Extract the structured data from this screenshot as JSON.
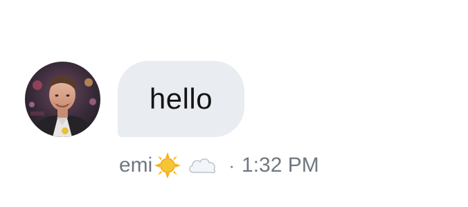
{
  "message": {
    "text": "hello",
    "sender": {
      "name": "emi",
      "status_icons": [
        "sun-emoji",
        "cloud-emoji"
      ],
      "avatar_icon": "profile-photo"
    },
    "separator": "·",
    "timestamp": "1:32 PM"
  },
  "colors": {
    "bubble_background": "#e9ecf0",
    "message_text": "#141414",
    "meta_text": "#6f7781",
    "sun": "#f7b21b",
    "cloud": "#dfe6ee"
  }
}
